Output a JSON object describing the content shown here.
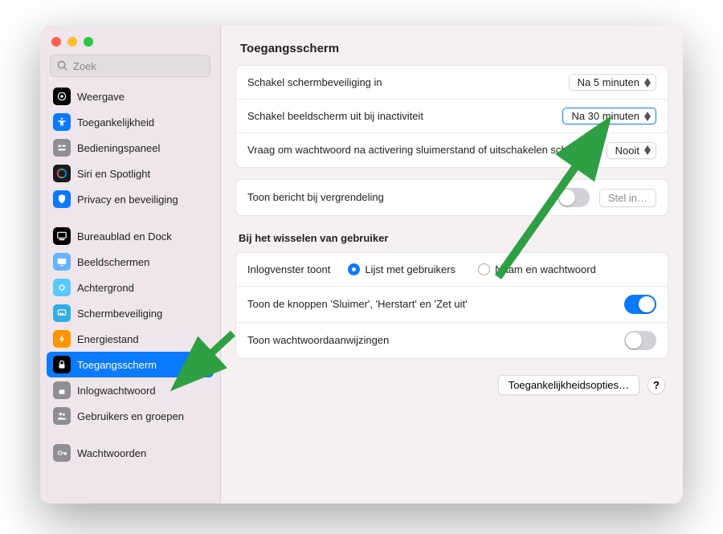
{
  "search": {
    "placeholder": "Zoek"
  },
  "sidebar": {
    "items": [
      {
        "label": "Weergave",
        "icon": "weergave-icon",
        "cls": "ic-black"
      },
      {
        "label": "Toegankelijkheid",
        "icon": "accessibility-icon",
        "cls": "ic-blue"
      },
      {
        "label": "Bedieningspaneel",
        "icon": "control-center-icon",
        "cls": "ic-gray"
      },
      {
        "label": "Siri en Spotlight",
        "icon": "siri-icon",
        "cls": "ic-dark"
      },
      {
        "label": "Privacy en beveiliging",
        "icon": "privacy-icon",
        "cls": "ic-blue"
      },
      {
        "spacer": true
      },
      {
        "label": "Bureaublad en Dock",
        "icon": "dock-icon",
        "cls": "ic-black"
      },
      {
        "label": "Beeldschermen",
        "icon": "displays-icon",
        "cls": "ic-sky"
      },
      {
        "label": "Achtergrond",
        "icon": "wallpaper-icon",
        "cls": "ic-teal"
      },
      {
        "label": "Schermbeveiliging",
        "icon": "screensaver-icon",
        "cls": "ic-cyan"
      },
      {
        "label": "Energiestand",
        "icon": "battery-icon",
        "cls": "ic-orange"
      },
      {
        "label": "Toegangsscherm",
        "icon": "lock-icon",
        "cls": "ic-black",
        "selected": true
      },
      {
        "label": "Inlogwachtwoord",
        "icon": "password-icon",
        "cls": "ic-gray"
      },
      {
        "label": "Gebruikers en groepen",
        "icon": "users-icon",
        "cls": "ic-gray"
      },
      {
        "spacer": true
      },
      {
        "label": "Wachtwoorden",
        "icon": "key-icon",
        "cls": "ic-gray"
      }
    ]
  },
  "header": {
    "title": "Toegangsscherm"
  },
  "settings": {
    "screensaver": {
      "label": "Schakel schermbeveiliging in",
      "value": "Na 5 minuten"
    },
    "display_off": {
      "label": "Schakel beeldscherm uit bij inactiviteit",
      "value": "Na 30 minuten"
    },
    "require_password": {
      "label": "Vraag om wachtwoord na activering sluimerstand of uitschakelen scherm",
      "value": "Nooit"
    },
    "lock_message": {
      "label": "Toon bericht bij vergrendeling",
      "on": false,
      "button": "Stel in…"
    },
    "section_title": "Bij het wisselen van gebruiker",
    "login_window": {
      "label": "Inlogvenster toont",
      "opt1": "Lijst met gebruikers",
      "opt2": "Naam en wachtwoord",
      "selected": "opt1"
    },
    "show_buttons": {
      "label": "Toon de knoppen 'Sluimer', 'Herstart' en 'Zet uit'",
      "on": true
    },
    "password_hints": {
      "label": "Toon wachtwoordaanwijzingen",
      "on": false
    }
  },
  "footer": {
    "accessibility": "Toegankelijkheidsopties…",
    "help": "?"
  }
}
